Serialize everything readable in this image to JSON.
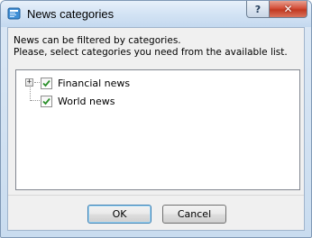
{
  "window": {
    "title": "News categories",
    "help_label": "?",
    "close_label": "✕"
  },
  "description": {
    "line1": "News can be filtered by categories.",
    "line2": "Please, select categories you need from the available list."
  },
  "tree": {
    "expander_symbol": "+",
    "items": [
      {
        "label": "Financial news",
        "checked": true
      },
      {
        "label": "World news",
        "checked": true
      }
    ]
  },
  "buttons": {
    "ok": "OK",
    "cancel": "Cancel"
  }
}
